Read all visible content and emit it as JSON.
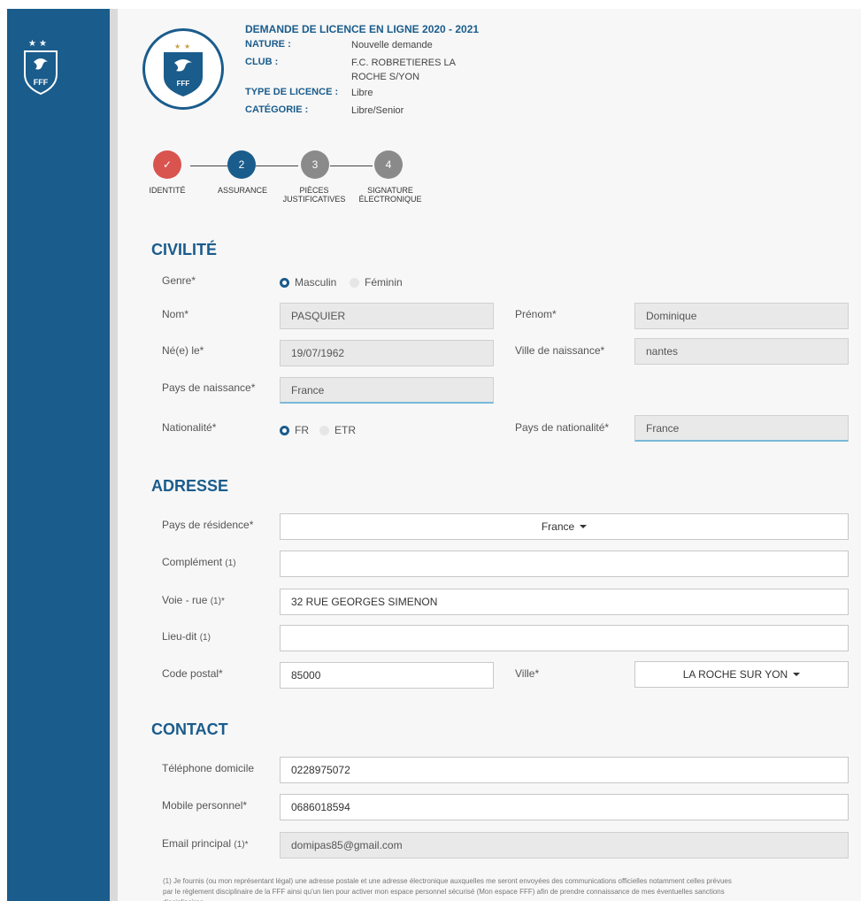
{
  "sidebar": {
    "logo_text": "FFF"
  },
  "header": {
    "title": "DEMANDE DE LICENCE EN LIGNE 2020 - 2021",
    "logo_text": "FFF",
    "rows": [
      {
        "label": "NATURE :",
        "value": "Nouvelle demande"
      },
      {
        "label": "CLUB :",
        "value": "F.C. ROBRETIERES LA",
        "value2": "ROCHE S/YON"
      },
      {
        "label": "TYPE DE LICENCE :",
        "value": "Libre"
      },
      {
        "label": "CATÉGORIE :",
        "value": "Libre/Senior"
      }
    ]
  },
  "stepper": {
    "steps": [
      {
        "number": "✓",
        "label": "IDENTITÉ",
        "label2": "",
        "state": "done",
        "color": "#d9534f"
      },
      {
        "number": "2",
        "label": "ASSURANCE",
        "label2": "",
        "state": "current",
        "color": "#1a5c8c"
      },
      {
        "number": "3",
        "label": "PIÈCES",
        "label2": "JUSTIFICATIVES",
        "state": "todo",
        "color": "#8a8a8a"
      },
      {
        "number": "4",
        "label": "SIGNATURE",
        "label2": "ÉLECTRONIQUE",
        "state": "todo",
        "color": "#8a8a8a"
      }
    ]
  },
  "civilite": {
    "title": "CIVILITÉ",
    "genre_label": "Genre*",
    "genre_options": [
      "Masculin",
      "Féminin"
    ],
    "genre_selected": "Masculin",
    "nom_label": "Nom*",
    "nom_value": "PASQUIER",
    "prenom_label": "Prénom*",
    "prenom_value": "Dominique",
    "ne_le_label": "Né(e) le*",
    "ne_le_value": "19/07/1962",
    "ville_naissance_label": "Ville de naissance*",
    "ville_naissance_value": "nantes",
    "pays_naissance_label": "Pays de naissance*",
    "pays_naissance_value": "France",
    "nationalite_label": "Nationalité*",
    "nationalite_options": [
      "FR",
      "ETR"
    ],
    "nationalite_selected": "FR",
    "pays_nationalite_label": "Pays de nationalité*",
    "pays_nationalite_value": "France"
  },
  "adresse": {
    "title": "ADRESSE",
    "pays_residence_label": "Pays de résidence*",
    "pays_residence_value": "France",
    "complement_label": "Complément",
    "complement_note": "(1)",
    "complement_value": "",
    "voie_label": "Voie - rue",
    "voie_note": "(1)*",
    "voie_value": "32 RUE GEORGES SIMENON",
    "lieu_dit_label": "Lieu-dit",
    "lieu_dit_note": "(1)",
    "lieu_dit_value": "",
    "code_postal_label": "Code postal*",
    "code_postal_value": "85000",
    "ville_label": "Ville*",
    "ville_value": "LA ROCHE SUR YON"
  },
  "contact": {
    "title": "CONTACT",
    "tel_domicile_label": "Téléphone domicile",
    "tel_domicile_value": "0228975072",
    "mobile_label": "Mobile personnel*",
    "mobile_value": "0686018594",
    "email_label": "Email principal",
    "email_note": "(1)*",
    "email_value": "domipas85@gmail.com",
    "footnote": "(1) Je fournis (ou mon représentant légal) une adresse postale et une adresse électronique auxquelles me seront envoyées des communications officielles notamment celles prévues par le règlement disciplinaire de la FFF ainsi qu'un lien pour activer mon espace personnel sécurisé (Mon espace FFF) afin de prendre connaissance de mes éventuelles sanctions disciplinaires."
  },
  "colors": {
    "brand": "#1a5c8c",
    "done": "#d9534f",
    "todo": "#8a8a8a"
  }
}
